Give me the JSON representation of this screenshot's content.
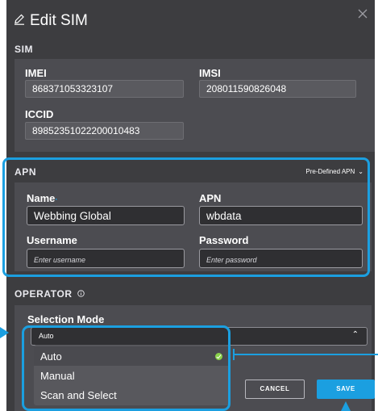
{
  "dialog": {
    "title": "Edit SIM",
    "close_icon": "close-icon",
    "edit_icon": "pencil-icon"
  },
  "sim": {
    "section_label": "SIM",
    "imei_label": "IMEI",
    "imei_value": "868371053323107",
    "imsi_label": "IMSI",
    "imsi_value": "208011590826048",
    "iccid_label": "ICCID",
    "iccid_value": "89852351022200010483"
  },
  "apn": {
    "section_label": "APN",
    "predefined_label": "Pre-Defined APN",
    "name_label": "Name",
    "name_value": "Webbing Global",
    "apn_label": "APN",
    "apn_value": "wbdata",
    "username_label": "Username",
    "username_placeholder": "Enter username",
    "password_label": "Password",
    "password_placeholder": "Enter password"
  },
  "operator": {
    "section_label": "OPERATOR",
    "info_icon": "info-icon",
    "selection_mode_label": "Selection Mode",
    "selected_value": "Auto",
    "options": [
      "Auto",
      "Manual",
      "Scan and Select"
    ]
  },
  "actions": {
    "cancel_label": "CANCEL",
    "save_label": "SAVE"
  },
  "colors": {
    "accent": "#1b9fe0",
    "modal_bg": "#3d3d40",
    "panel_bg": "#4c4c51",
    "check": "#8ad24a"
  }
}
